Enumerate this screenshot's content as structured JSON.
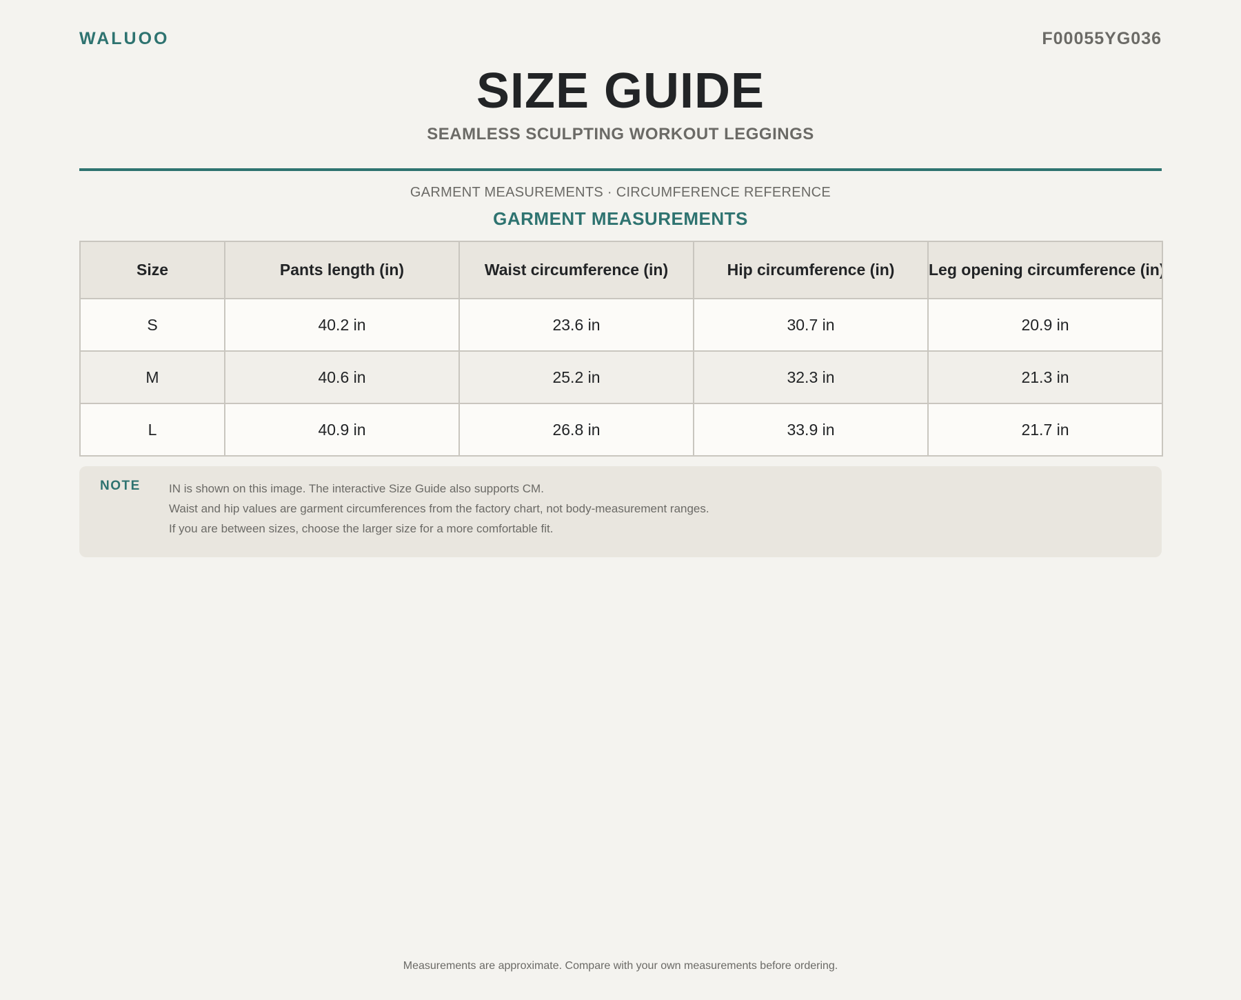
{
  "header": {
    "brand": "WALUOO",
    "sku": "F00055YG036",
    "title": "SIZE GUIDE",
    "subtitle": "SEAMLESS SCULPTING WORKOUT LEGGINGS"
  },
  "section": {
    "caption": "GARMENT MEASUREMENTS · CIRCUMFERENCE REFERENCE",
    "heading": "GARMENT MEASUREMENTS"
  },
  "table": {
    "headers": [
      "Size",
      "Pants length (in)",
      "Waist circumference (in)",
      "Hip circumference (in)",
      "Leg opening circumference (in)"
    ],
    "rows": [
      [
        "S",
        "40.2 in",
        "23.6 in",
        "30.7 in",
        "20.9 in"
      ],
      [
        "M",
        "40.6 in",
        "25.2 in",
        "32.3 in",
        "21.3 in"
      ],
      [
        "L",
        "40.9 in",
        "26.8 in",
        "33.9 in",
        "21.7 in"
      ]
    ]
  },
  "note": {
    "label": "NOTE",
    "lines": [
      "IN is shown on this image. The interactive Size Guide also supports CM.",
      "Waist and hip values are garment circumferences from the factory chart, not body-measurement ranges.",
      "If you are between sizes, choose the larger size for a more comfortable fit."
    ]
  },
  "footer": {
    "text": "Measurements are approximate. Compare with your own measurements before ordering."
  },
  "colors": {
    "accent": "#2e7370",
    "background": "#f4f3ef",
    "muted_text": "#6b6a66",
    "header_row": "#e9e6df"
  }
}
